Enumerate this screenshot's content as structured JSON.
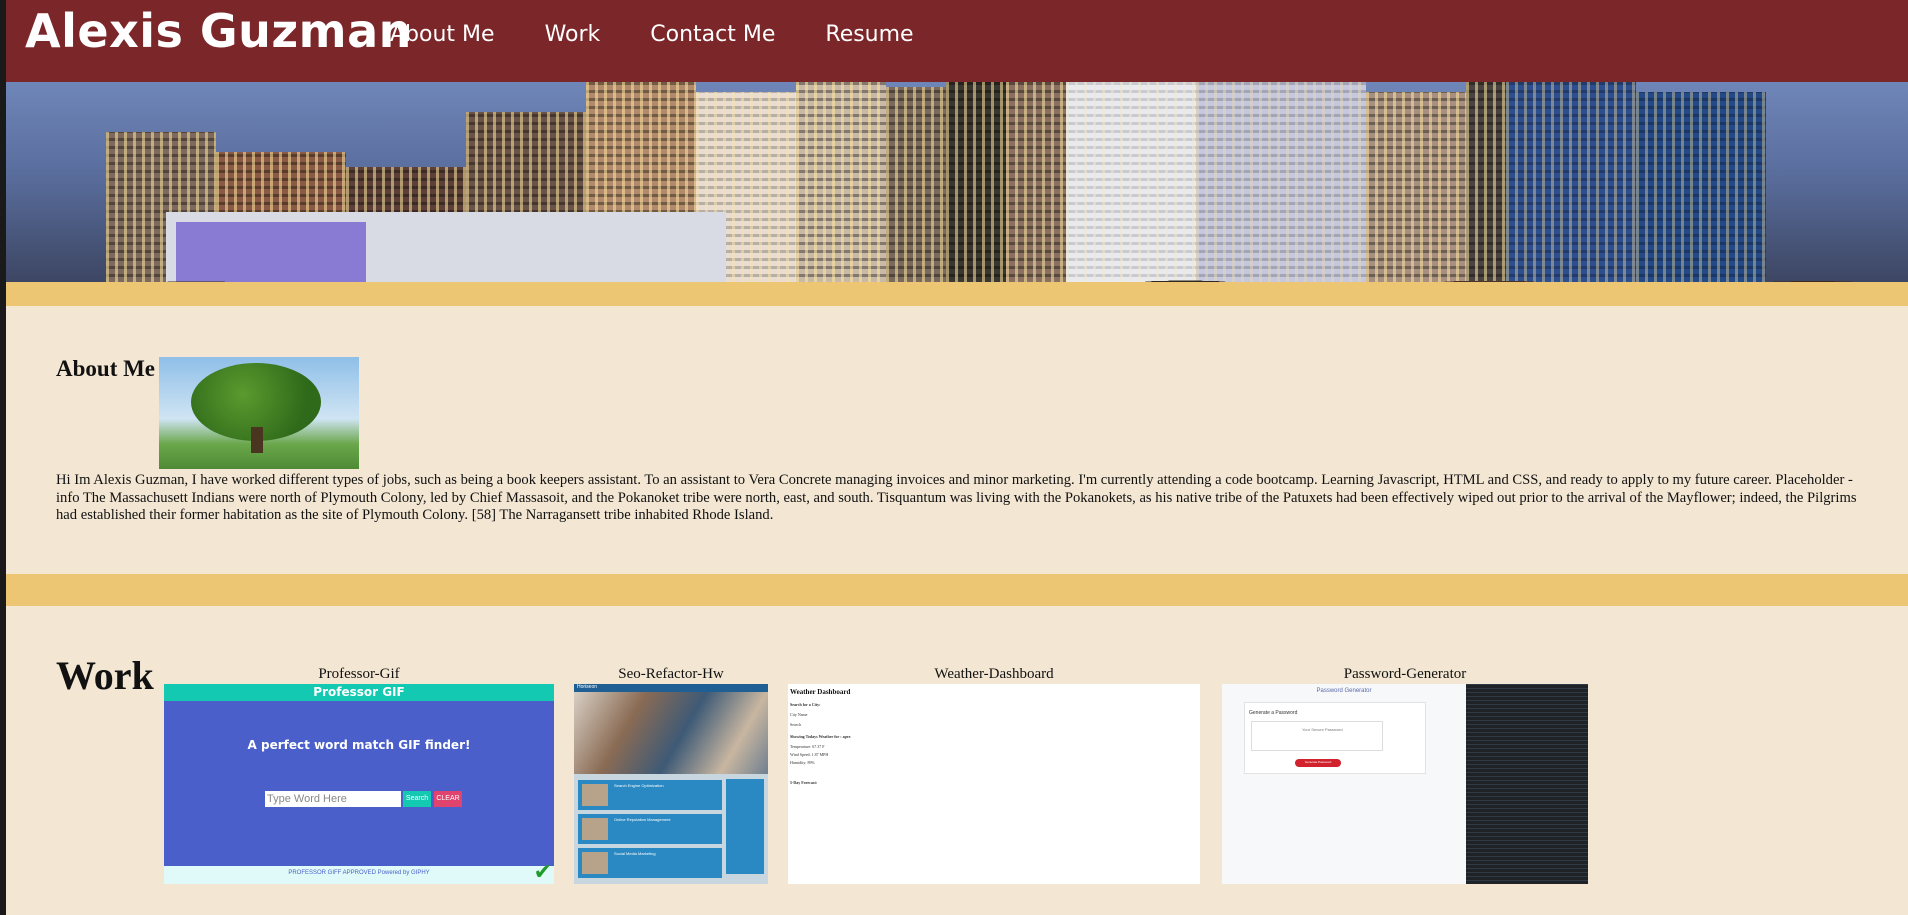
{
  "header": {
    "brand": "Alexis Guzman",
    "nav": [
      "About Me",
      "Work",
      "Contact Me",
      "Resume"
    ],
    "background": "#7b2629"
  },
  "hero": {
    "image": "city-skyline-image"
  },
  "about": {
    "title": "About Me",
    "image": "oak-tree-image",
    "text": "Hi Im Alexis Guzman, I have worked different types of jobs, such as being a book keepers assistant. To an assistant to Vera Concrete managing invoices and minor marketing. I'm currently attending a code bootcamp. Learning Javascript, HTML and CSS, and ready to apply to my future career. Placeholder - info The Massachusett Indians were north of Plymouth Colony, led by Chief Massasoit, and the Pokanoket tribe were north, east, and south. Tisquantum was living with the Pokanokets, as his native tribe of the Patuxets had been effectively wiped out prior to the arrival of the Mayflower; indeed, the Pilgrims had established their former habitation as the site of Plymouth Colony. [58] The Narragansett tribe inhabited Rhode Island."
  },
  "work": {
    "title": "Work",
    "projects": [
      {
        "caption": "Professor-Gif",
        "screenshot": {
          "header": "Professor GIF",
          "tagline": "A perfect word match GIF finder!",
          "input_placeholder": "Type Word Here",
          "search_label": "Search",
          "clear_label": "CLEAR",
          "footer": "PROFESSOR GIFF APPROVED Powered by GIPHY"
        }
      },
      {
        "caption": "Seo-Refactor-Hw",
        "screenshot": {
          "nav": "Horiseon",
          "cards": [
            "Search Engine Optimization",
            "Online Reputation Management",
            "Social Media Marketing"
          ]
        }
      },
      {
        "caption": "Weather-Dashboard",
        "screenshot": {
          "title": "Weather Dashboard",
          "lines": [
            "Search for a City:",
            "City Name",
            "Search",
            "Showing Todays Weather for : apex",
            "Temperature: 67.37 F",
            "Wind Speed: 1.87 MPH",
            "Humidity: 89%",
            "5-Day Forecast:"
          ]
        }
      },
      {
        "caption": "Password-Generator",
        "screenshot": {
          "title": "Password Generator",
          "card_title": "Generate a Password",
          "placeholder": "Your Secure Password",
          "button": "Generate Password"
        }
      }
    ]
  },
  "colors": {
    "page_bg": "#f3e6d3",
    "band": "#ecc673",
    "header": "#7b2629"
  }
}
